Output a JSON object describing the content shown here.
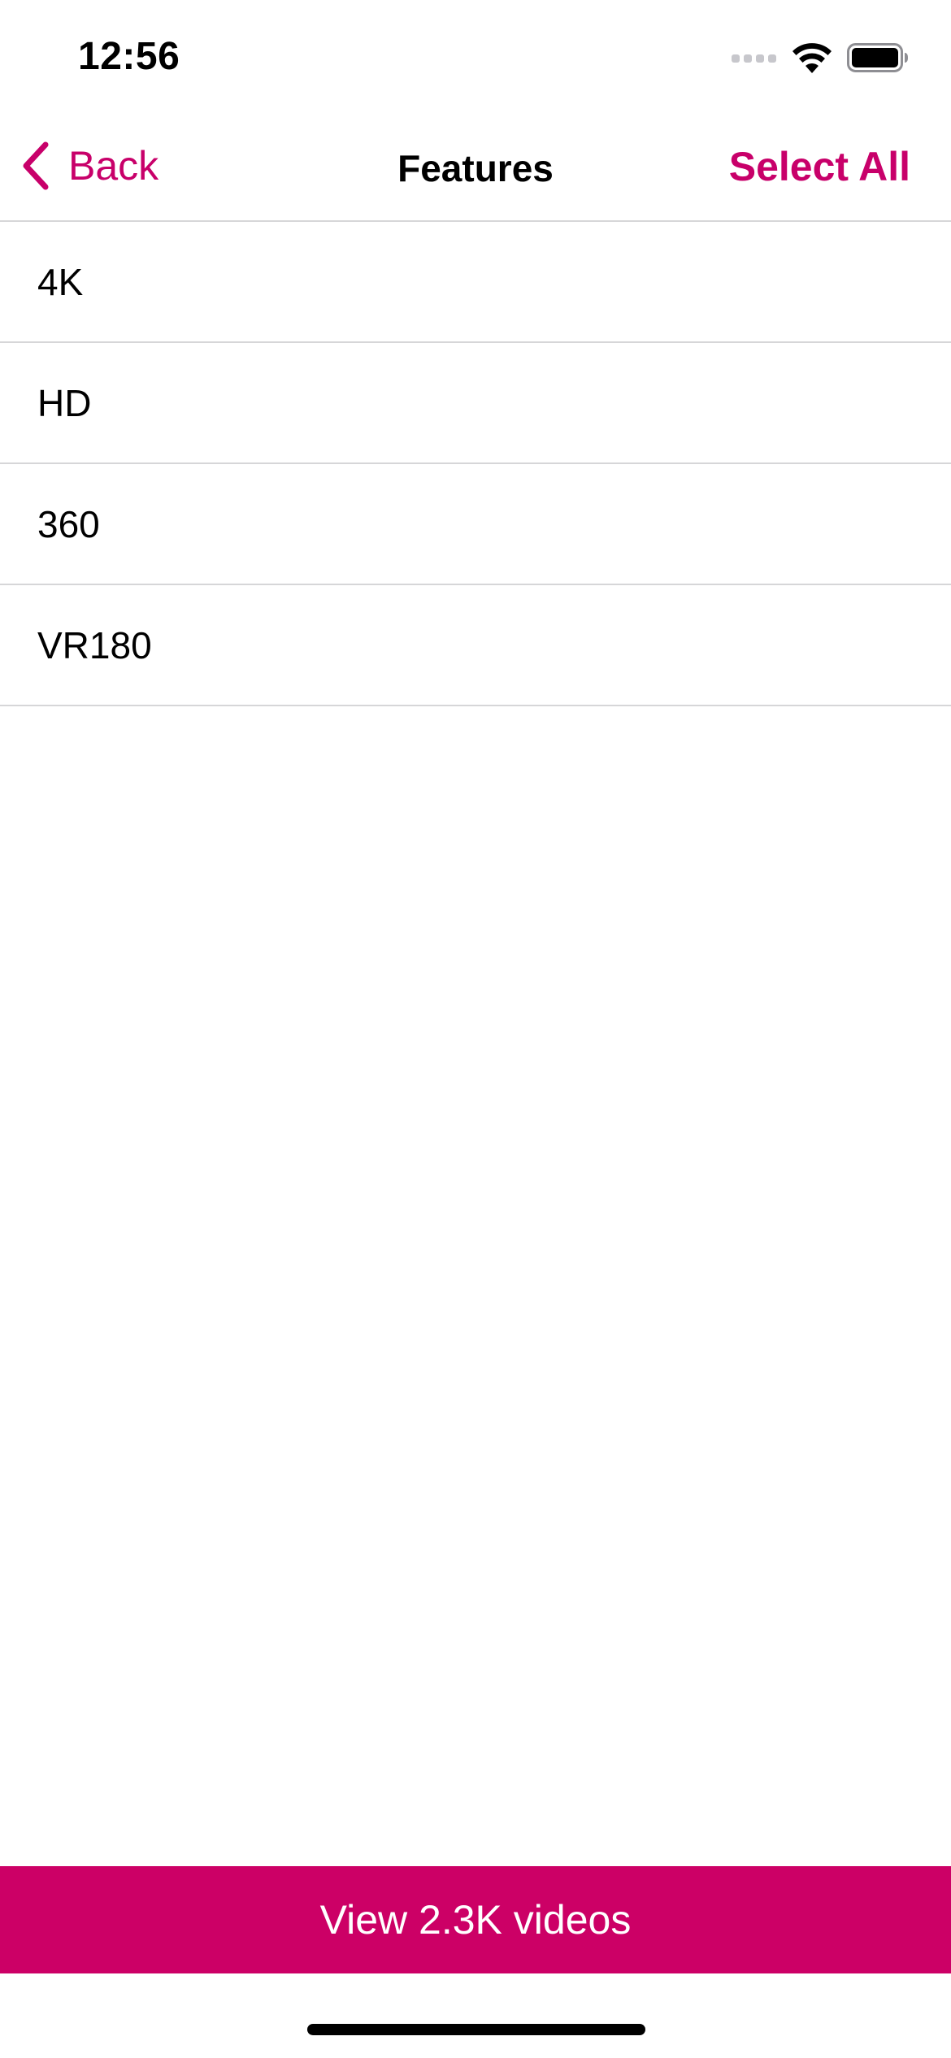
{
  "status_bar": {
    "time": "12:56",
    "icons": [
      "cellular-signal-icon",
      "wifi-icon",
      "battery-icon"
    ]
  },
  "nav": {
    "back_label": "Back",
    "title": "Features",
    "select_all_label": "Select All"
  },
  "features": [
    {
      "label": "4K"
    },
    {
      "label": "HD"
    },
    {
      "label": "360"
    },
    {
      "label": "VR180"
    }
  ],
  "footer": {
    "view_button_label": "View 2.3K videos"
  },
  "colors": {
    "accent": "#c8006a",
    "button_background": "#cc0066",
    "divider": "#d6d6d8"
  }
}
